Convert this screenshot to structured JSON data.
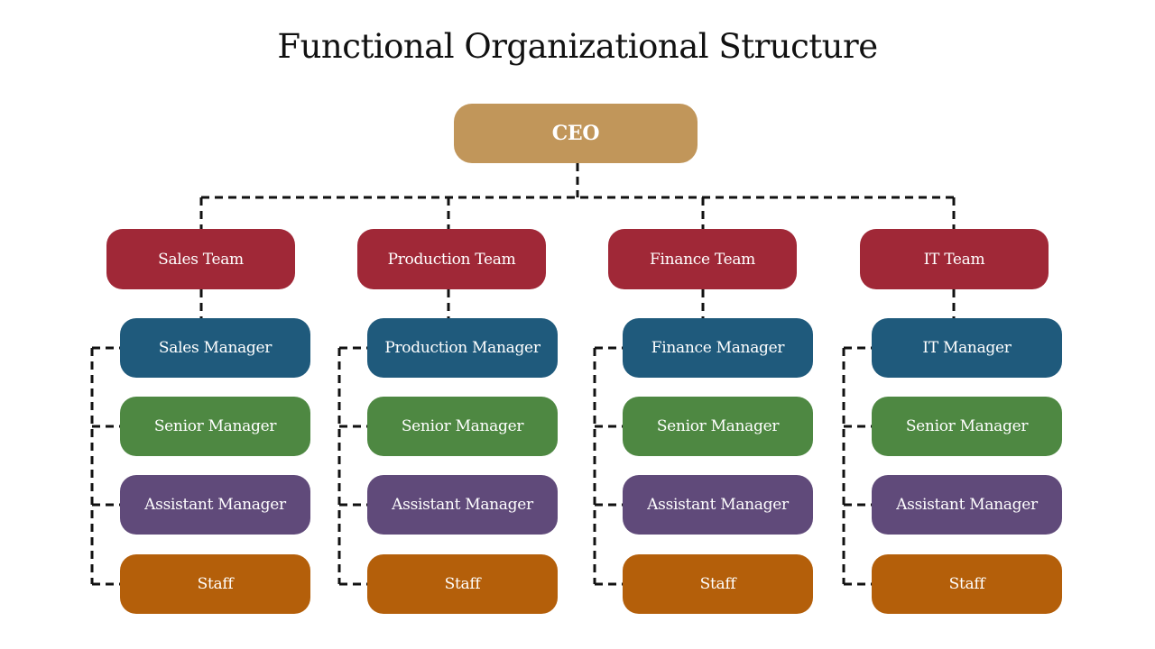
{
  "title": "Functional Organizational Structure",
  "colors": {
    "ceo": "#C1965A",
    "team": "#A02837",
    "manager": "#1F5A7C",
    "senior_manager": "#4E8842",
    "assistant_manager": "#604A7A",
    "staff": "#B45F0A",
    "connector": "#111111"
  },
  "ceo": {
    "label": "CEO"
  },
  "teams": [
    {
      "label": "Sales Team",
      "roles": [
        "Sales Manager",
        "Senior Manager",
        "Assistant Manager",
        "Staff"
      ]
    },
    {
      "label": "Production Team",
      "roles": [
        "Production Manager",
        "Senior Manager",
        "Assistant Manager",
        "Staff"
      ]
    },
    {
      "label": "Finance Team",
      "roles": [
        "Finance Manager",
        "Senior Manager",
        "Assistant Manager",
        "Staff"
      ]
    },
    {
      "label": "IT Team",
      "roles": [
        "IT Manager",
        "Senior Manager",
        "Assistant Manager",
        "Staff"
      ]
    }
  ]
}
